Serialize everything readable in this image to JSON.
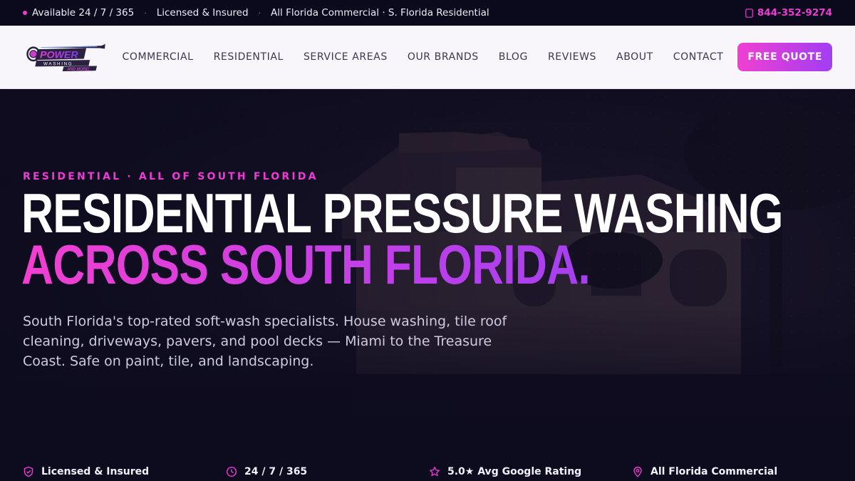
{
  "topbar": {
    "item1": "Available 24 / 7 / 365",
    "item2": "Licensed & Insured",
    "item3": "All Florida Commercial · S. Florida Residential",
    "phone": "844-352-9274",
    "separator": "·"
  },
  "logo": {
    "line1": "POWER",
    "line2": "WASHING",
    "line3": "AND MORE!"
  },
  "nav": {
    "links": [
      "COMMERCIAL",
      "RESIDENTIAL",
      "SERVICE AREAS",
      "OUR BRANDS",
      "BLOG",
      "REVIEWS",
      "ABOUT",
      "CONTACT"
    ],
    "cta": "FREE QUOTE"
  },
  "hero": {
    "eyebrow": "RESIDENTIAL · ALL OF SOUTH FLORIDA",
    "title_line1": "RESIDENTIAL PRESSURE WASHING",
    "title_line2": "ACROSS SOUTH FLORIDA.",
    "subtitle": "South Florida's top-rated soft-wash specialists. House washing, tile roof cleaning, driveways, pavers, and pool decks — Miami to the Treasure Coast. Safe on paint, tile, and landscaping."
  },
  "features": [
    {
      "icon": "shield-check-icon",
      "label": "Licensed & Insured"
    },
    {
      "icon": "clock-icon",
      "label": "24 / 7 / 365"
    },
    {
      "icon": "star-icon",
      "label": "5.0★ Avg Google Rating"
    },
    {
      "icon": "map-pin-icon",
      "label": "All Florida Commercial"
    }
  ],
  "colors": {
    "accent_pink": "#ee3bd6",
    "accent_purple": "#9a3ff3",
    "dark_bg": "#0d0b1e"
  }
}
